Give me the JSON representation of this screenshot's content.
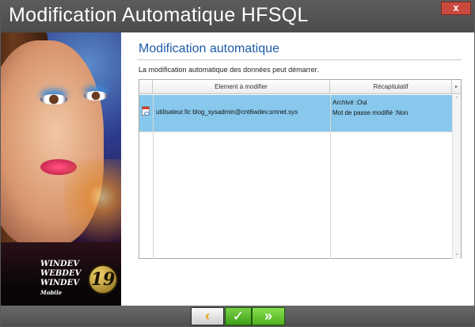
{
  "window": {
    "title": "Modification Automatique HFSQL",
    "close_label": "x"
  },
  "panel": {
    "heading": "Modification automatique",
    "description": "La modification automatique des données peut démarrer."
  },
  "table": {
    "columns": [
      "Element à modifier",
      "Récapitulatif"
    ],
    "rows": [
      {
        "element": "utilisateur.fic blog_sysadmin@cnt6wdev.smnet.sys",
        "recap": [
          "Archivé :Oui",
          "Mot de passe modifié :Non"
        ]
      }
    ]
  },
  "branding": {
    "logo_lines": [
      "WINDEV",
      "WEBDEV",
      "WINDEV"
    ],
    "logo_sub": "Mobile",
    "version": "19"
  },
  "footer": {
    "back_icon": "chevron-left-icon",
    "finish_icon": "check-icon",
    "next_icon": "double-chevron-right-icon"
  }
}
